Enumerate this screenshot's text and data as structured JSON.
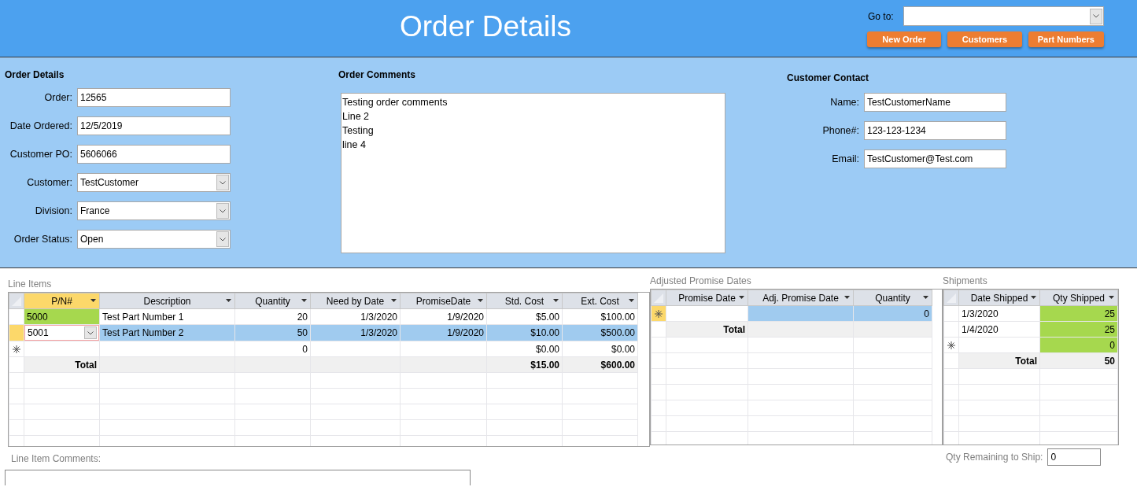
{
  "header": {
    "title": "Order Details",
    "goto": {
      "label": "Go to:"
    },
    "buttons": [
      "New Order",
      "Customers",
      "Part Numbers"
    ]
  },
  "order_details": {
    "heading": "Order Details",
    "fields": [
      {
        "label": "Order:",
        "value": "12565",
        "kind": "text"
      },
      {
        "label": "Date Ordered:",
        "value": "12/5/2019",
        "kind": "text"
      },
      {
        "label": "Customer PO:",
        "value": "5606066",
        "kind": "text"
      },
      {
        "label": "Customer:",
        "value": "TestCustomer",
        "kind": "combo"
      },
      {
        "label": "Division:",
        "value": "France",
        "kind": "combo"
      },
      {
        "label": "Order Status:",
        "value": "Open",
        "kind": "combo"
      }
    ]
  },
  "order_comments": {
    "heading": "Order Comments",
    "lines": [
      "Testing order comments",
      "Line 2",
      "Testing",
      "line 4"
    ]
  },
  "customer_contact": {
    "heading": "Customer Contact",
    "fields": [
      {
        "label": "Name:",
        "value": "TestCustomerName",
        "kind": "text"
      },
      {
        "label": "Phone#:",
        "value": "123-123-1234",
        "kind": "text"
      },
      {
        "label": "Email:",
        "value": "TestCustomer@Test.com",
        "kind": "text"
      }
    ]
  },
  "line_items": {
    "title": "Line Items",
    "columns": [
      {
        "label": "P/N#",
        "kind": "combo",
        "current": true,
        "conditional": true
      },
      {
        "label": "Description",
        "kind": "text",
        "current": false
      },
      {
        "label": "Quantity",
        "kind": "number",
        "current": false
      },
      {
        "label": "Need by Date",
        "kind": "number",
        "current": false
      },
      {
        "label": "PromiseDate",
        "kind": "number",
        "current": false
      },
      {
        "label": "Std. Cost",
        "kind": "number",
        "current": false
      },
      {
        "label": "Ext. Cost",
        "kind": "number",
        "current": false
      }
    ],
    "rows": [
      {
        "kind": "record",
        "selected": false,
        "cells": [
          "5000",
          "Test Part Number 1",
          "20",
          "1/3/2020",
          "1/9/2020",
          "$5.00",
          "$100.00"
        ]
      },
      {
        "kind": "record",
        "selected": true,
        "cells": [
          "5001",
          "Test Part Number 2",
          "50",
          "1/3/2020",
          "1/9/2020",
          "$10.00",
          "$500.00"
        ]
      },
      {
        "kind": "new",
        "selected": false,
        "cells": [
          "",
          "",
          "0",
          "",
          "",
          "$0.00",
          "$0.00"
        ]
      },
      {
        "kind": "total",
        "cells": [
          "Total",
          "",
          "",
          "",
          "",
          "$15.00",
          "$600.00"
        ]
      }
    ]
  },
  "adjusted_promise_dates": {
    "title": "Adjusted Promise Dates",
    "columns": [
      {
        "label": "Promise Date",
        "kind": "text",
        "current": false
      },
      {
        "label": "Adj. Promise Date",
        "kind": "text",
        "current": false
      },
      {
        "label": "Quantity",
        "kind": "number",
        "current": false
      }
    ],
    "rows": [
      {
        "kind": "new",
        "selected": true,
        "cells": [
          "",
          "",
          "0"
        ]
      },
      {
        "kind": "total",
        "cells": [
          "Total",
          "",
          ""
        ]
      }
    ]
  },
  "shipments": {
    "title": "Shipments",
    "columns": [
      {
        "label": "Date Shipped",
        "kind": "text",
        "current": false
      },
      {
        "label": "Qty Shipped",
        "kind": "number",
        "current": false,
        "conditional": true
      }
    ],
    "rows": [
      {
        "kind": "record",
        "selected": false,
        "cells": [
          "1/3/2020",
          "25"
        ]
      },
      {
        "kind": "record",
        "selected": false,
        "cells": [
          "1/4/2020",
          "25"
        ]
      },
      {
        "kind": "new",
        "selected": false,
        "cells": [
          "",
          "0"
        ]
      },
      {
        "kind": "total",
        "cells": [
          "Total",
          "50"
        ]
      }
    ],
    "remaining": {
      "label": "Qty Remaining to Ship:",
      "value": "0"
    }
  },
  "line_item_comments": {
    "label": "Line Item Comments:"
  }
}
